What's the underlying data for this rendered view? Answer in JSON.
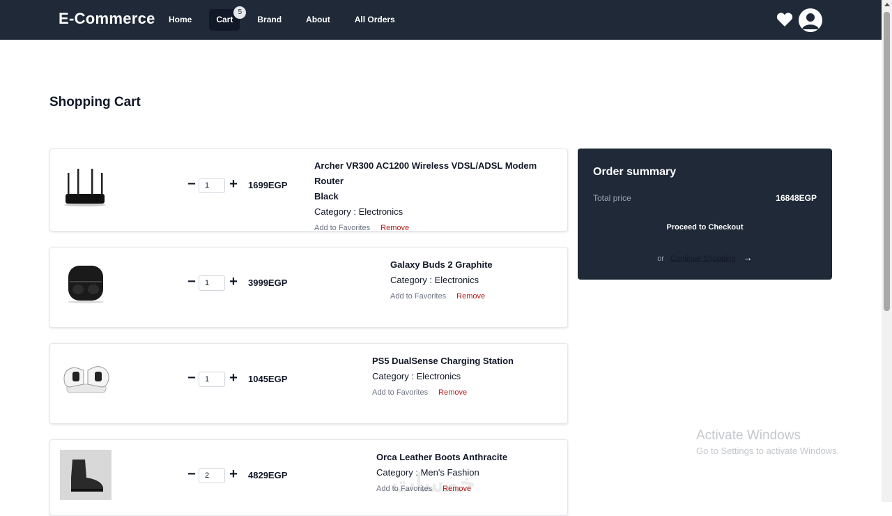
{
  "nav": {
    "brand": "E-Commerce",
    "links": [
      "Home",
      "Cart",
      "Brand",
      "About",
      "All Orders"
    ],
    "cart_count": "5",
    "active_link": "Cart",
    "icons": [
      "heart-icon",
      "user-avatar-icon"
    ]
  },
  "page": {
    "title": "Shopping Cart"
  },
  "cart": {
    "items": [
      {
        "name_line1": "Archer VR300 AC1200 Wireless VDSL/ADSL Modem Router",
        "name_line2": "Black",
        "category": "Category : Electronics",
        "qty": "1",
        "price": "1699EGP",
        "add_fav": "Add to Favorites",
        "remove": "Remove",
        "icon": "router-image"
      },
      {
        "name_line1": "Galaxy Buds 2 Graphite",
        "name_line2": "",
        "category": "Category : Electronics",
        "qty": "1",
        "price": "3999EGP",
        "add_fav": "Add to Favorites",
        "remove": "Remove",
        "icon": "earbuds-image"
      },
      {
        "name_line1": "PS5 DualSense Charging Station",
        "name_line2": "",
        "category": "Category : Electronics",
        "qty": "1",
        "price": "1045EGP",
        "add_fav": "Add to Favorites",
        "remove": "Remove",
        "icon": "controller-charger-image"
      },
      {
        "name_line1": "Orca Leather Boots Anthracite",
        "name_line2": "",
        "category": "Category : Men's Fashion",
        "qty": "2",
        "price": "4829EGP",
        "add_fav": "Add to Favorites",
        "remove": "Remove",
        "icon": "boot-image"
      }
    ],
    "minus_symbol": "−",
    "plus_symbol": "+"
  },
  "summary": {
    "title": "Order summary",
    "total_label": "Total price",
    "total_value": "16848EGP",
    "checkout": "Proceed to Checkout",
    "or": "or",
    "continue": "Continue Shopping",
    "arrow": "→"
  },
  "os": {
    "activate_title": "Activate Windows",
    "activate_sub": "Go to Settings to activate Windows.",
    "watermark": "خمسات"
  },
  "colors": {
    "nav_bg": "#1f2937",
    "remove": "#b91c1c",
    "summary_bg": "#1f2937"
  }
}
